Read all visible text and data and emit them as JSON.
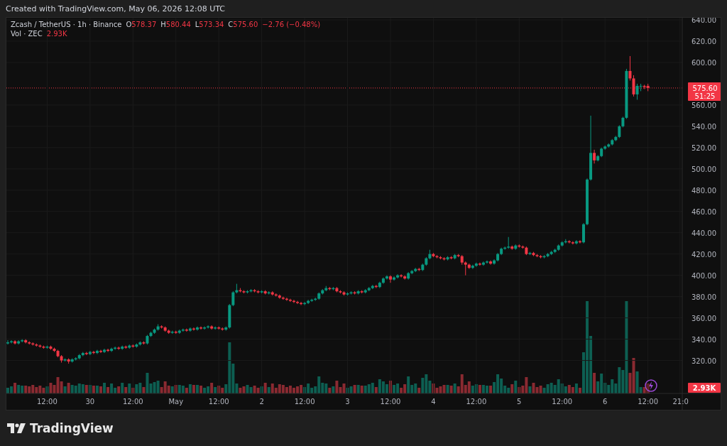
{
  "caption": "Created with TradingView.com, May 06, 2026 12:08 UTC",
  "legend": {
    "symbol": "Zcash / TetherUS · 1h · Binance",
    "ohlc": [
      {
        "label": "O",
        "value": "578.37"
      },
      {
        "label": "H",
        "value": "580.44"
      },
      {
        "label": "L",
        "value": "573.34"
      },
      {
        "label": "C",
        "value": "575.60"
      }
    ],
    "change": "−2.76 (−0.48%)",
    "volume_label": "Vol · ZEC",
    "volume_value": "2.93K"
  },
  "chart": {
    "chart_data": {
      "type": "candlestick",
      "categories": [
        null,
        null,
        null,
        null,
        null,
        null,
        null,
        null,
        null,
        null,
        null,
        "12:00",
        null,
        null,
        null,
        null,
        null,
        null,
        null,
        null,
        null,
        null,
        null,
        "30",
        null,
        null,
        null,
        null,
        null,
        null,
        null,
        null,
        null,
        null,
        null,
        "12:00",
        null,
        null,
        null,
        null,
        null,
        null,
        null,
        null,
        null,
        null,
        null,
        "May",
        null,
        null,
        null,
        null,
        null,
        null,
        null,
        null,
        null,
        null,
        null,
        "12:00",
        null,
        null,
        null,
        null,
        null,
        null,
        null,
        null,
        null,
        null,
        null,
        "2",
        null,
        null,
        null,
        null,
        null,
        null,
        null,
        null,
        null,
        null,
        null,
        "12:00",
        null,
        null,
        null,
        null,
        null,
        null,
        null,
        null,
        null,
        null,
        null,
        "3",
        null,
        null,
        null,
        null,
        null,
        null,
        null,
        null,
        null,
        null,
        null,
        "12:00",
        null,
        null,
        null,
        null,
        null,
        null,
        null,
        null,
        null,
        null,
        null,
        "4",
        null,
        null,
        null,
        null,
        null,
        null,
        null,
        null,
        null,
        null,
        null,
        "12:00",
        null,
        null,
        null,
        null,
        null,
        null,
        null,
        null,
        null,
        null,
        null,
        "5",
        null,
        null,
        null,
        null,
        null,
        null,
        null,
        null,
        null,
        null,
        null,
        "12:00",
        null,
        null,
        null,
        null,
        null,
        null,
        null,
        null,
        null,
        null,
        null,
        "6",
        null,
        null,
        null,
        null,
        null,
        null,
        null,
        null,
        null,
        null,
        null,
        "12:00",
        null,
        null,
        null,
        null,
        null,
        null,
        null,
        null,
        "21:0"
      ],
      "ohlc": [
        [
          336,
          339,
          335,
          337
        ],
        [
          337,
          339,
          336,
          338
        ],
        [
          338,
          339,
          335,
          336
        ],
        [
          336,
          339,
          335,
          338
        ],
        [
          338,
          340,
          337,
          339
        ],
        [
          339,
          340,
          336,
          337
        ],
        [
          337,
          338,
          335,
          336
        ],
        [
          336,
          337,
          334,
          335
        ],
        [
          335,
          336,
          333,
          334
        ],
        [
          334,
          335,
          332,
          333
        ],
        [
          333,
          334,
          331,
          332
        ],
        [
          332,
          334,
          331,
          333
        ],
        [
          333,
          334,
          330,
          331
        ],
        [
          331,
          332,
          328,
          329
        ],
        [
          329,
          330,
          323,
          324
        ],
        [
          324,
          325,
          318,
          320
        ],
        [
          320,
          322,
          319,
          321
        ],
        [
          321,
          322,
          317,
          319
        ],
        [
          319,
          322,
          318,
          321
        ],
        [
          321,
          323,
          320,
          322
        ],
        [
          322,
          326,
          321,
          325
        ],
        [
          325,
          328,
          324,
          327
        ],
        [
          327,
          328,
          325,
          326
        ],
        [
          326,
          329,
          325,
          328
        ],
        [
          328,
          329,
          326,
          327
        ],
        [
          327,
          330,
          326,
          329
        ],
        [
          329,
          330,
          327,
          328
        ],
        [
          328,
          331,
          327,
          330
        ],
        [
          330,
          331,
          328,
          329
        ],
        [
          329,
          332,
          328,
          331
        ],
        [
          331,
          333,
          330,
          332
        ],
        [
          332,
          333,
          330,
          331
        ],
        [
          331,
          334,
          330,
          333
        ],
        [
          333,
          334,
          331,
          332
        ],
        [
          332,
          335,
          331,
          334
        ],
        [
          334,
          335,
          332,
          333
        ],
        [
          333,
          336,
          332,
          335
        ],
        [
          335,
          338,
          334,
          337
        ],
        [
          337,
          338,
          335,
          336
        ],
        [
          336,
          344,
          335,
          343
        ],
        [
          343,
          347,
          342,
          346
        ],
        [
          346,
          350,
          345,
          349
        ],
        [
          349,
          354,
          348,
          352
        ],
        [
          352,
          353,
          350,
          351
        ],
        [
          351,
          352,
          347,
          348
        ],
        [
          348,
          349,
          345,
          346
        ],
        [
          346,
          348,
          345,
          347
        ],
        [
          347,
          348,
          345,
          346
        ],
        [
          346,
          349,
          345,
          348
        ],
        [
          348,
          350,
          347,
          349
        ],
        [
          349,
          350,
          347,
          348
        ],
        [
          348,
          351,
          347,
          350
        ],
        [
          350,
          351,
          348,
          349
        ],
        [
          349,
          352,
          348,
          351
        ],
        [
          351,
          352,
          349,
          350
        ],
        [
          350,
          352,
          349,
          351
        ],
        [
          351,
          353,
          350,
          352
        ],
        [
          352,
          353,
          349,
          350
        ],
        [
          350,
          352,
          349,
          351
        ],
        [
          351,
          352,
          349,
          350
        ],
        [
          350,
          351,
          348,
          349
        ],
        [
          349,
          352,
          348,
          351
        ],
        [
          351,
          373,
          350,
          372
        ],
        [
          372,
          385,
          371,
          384
        ],
        [
          384,
          392,
          383,
          386
        ],
        [
          386,
          388,
          384,
          385
        ],
        [
          385,
          386,
          383,
          384
        ],
        [
          384,
          386,
          383,
          385
        ],
        [
          385,
          387,
          384,
          386
        ],
        [
          386,
          387,
          384,
          385
        ],
        [
          385,
          386,
          383,
          384
        ],
        [
          384,
          386,
          383,
          385
        ],
        [
          385,
          386,
          382,
          383
        ],
        [
          383,
          385,
          382,
          384
        ],
        [
          384,
          385,
          381,
          382
        ],
        [
          382,
          383,
          380,
          381
        ],
        [
          381,
          382,
          378,
          379
        ],
        [
          379,
          380,
          377,
          378
        ],
        [
          378,
          379,
          376,
          377
        ],
        [
          377,
          378,
          375,
          376
        ],
        [
          376,
          377,
          374,
          375
        ],
        [
          375,
          376,
          373,
          374
        ],
        [
          374,
          375,
          372,
          373
        ],
        [
          373,
          375,
          372,
          374
        ],
        [
          374,
          377,
          373,
          376
        ],
        [
          376,
          378,
          375,
          377
        ],
        [
          377,
          379,
          376,
          378
        ],
        [
          378,
          384,
          377,
          383
        ],
        [
          383,
          387,
          382,
          386
        ],
        [
          386,
          390,
          385,
          388
        ],
        [
          388,
          389,
          386,
          387
        ],
        [
          387,
          389,
          386,
          388
        ],
        [
          388,
          389,
          384,
          385
        ],
        [
          385,
          386,
          383,
          384
        ],
        [
          384,
          385,
          381,
          382
        ],
        [
          382,
          384,
          381,
          383
        ],
        [
          383,
          385,
          382,
          384
        ],
        [
          384,
          385,
          382,
          383
        ],
        [
          383,
          386,
          382,
          385
        ],
        [
          385,
          386,
          383,
          384
        ],
        [
          384,
          387,
          383,
          386
        ],
        [
          386,
          389,
          385,
          388
        ],
        [
          388,
          391,
          387,
          390
        ],
        [
          390,
          391,
          388,
          389
        ],
        [
          389,
          394,
          388,
          393
        ],
        [
          393,
          398,
          392,
          397
        ],
        [
          397,
          400,
          396,
          399
        ],
        [
          399,
          400,
          393,
          396
        ],
        [
          396,
          399,
          395,
          398
        ],
        [
          398,
          401,
          397,
          400
        ],
        [
          400,
          401,
          398,
          399
        ],
        [
          399,
          400,
          396,
          397
        ],
        [
          397,
          403,
          396,
          402
        ],
        [
          402,
          405,
          401,
          404
        ],
        [
          404,
          407,
          403,
          406
        ],
        [
          406,
          407,
          404,
          405
        ],
        [
          405,
          411,
          404,
          410
        ],
        [
          410,
          417,
          409,
          416
        ],
        [
          416,
          424,
          415,
          420
        ],
        [
          420,
          421,
          417,
          418
        ],
        [
          418,
          419,
          416,
          417
        ],
        [
          417,
          418,
          415,
          416
        ],
        [
          416,
          417,
          414,
          415
        ],
        [
          415,
          418,
          414,
          417
        ],
        [
          417,
          418,
          415,
          416
        ],
        [
          416,
          420,
          415,
          419
        ],
        [
          419,
          420,
          417,
          418
        ],
        [
          418,
          419,
          410,
          412
        ],
        [
          412,
          413,
          400,
          410
        ],
        [
          410,
          411,
          406,
          407
        ],
        [
          407,
          410,
          406,
          409
        ],
        [
          409,
          412,
          408,
          411
        ],
        [
          411,
          412,
          409,
          410
        ],
        [
          410,
          413,
          409,
          412
        ],
        [
          412,
          414,
          411,
          413
        ],
        [
          413,
          414,
          410,
          411
        ],
        [
          411,
          415,
          410,
          414
        ],
        [
          414,
          421,
          413,
          420
        ],
        [
          420,
          426,
          419,
          425
        ],
        [
          425,
          427,
          424,
          426
        ],
        [
          426,
          436,
          425,
          427
        ],
        [
          427,
          428,
          424,
          425
        ],
        [
          425,
          429,
          424,
          428
        ],
        [
          428,
          429,
          426,
          427
        ],
        [
          427,
          428,
          425,
          426
        ],
        [
          426,
          427,
          419,
          420
        ],
        [
          420,
          422,
          419,
          421
        ],
        [
          421,
          422,
          418,
          419
        ],
        [
          419,
          420,
          417,
          418
        ],
        [
          418,
          419,
          416,
          417
        ],
        [
          417,
          419,
          416,
          418
        ],
        [
          418,
          421,
          417,
          420
        ],
        [
          420,
          423,
          419,
          422
        ],
        [
          422,
          425,
          421,
          424
        ],
        [
          424,
          429,
          423,
          428
        ],
        [
          428,
          432,
          427,
          431
        ],
        [
          431,
          434,
          430,
          432
        ],
        [
          432,
          433,
          430,
          431
        ],
        [
          431,
          432,
          429,
          430
        ],
        [
          430,
          433,
          429,
          432
        ],
        [
          432,
          433,
          430,
          431
        ],
        [
          431,
          449,
          430,
          448
        ],
        [
          448,
          491,
          447,
          490
        ],
        [
          490,
          550,
          489,
          515
        ],
        [
          515,
          518,
          505,
          508
        ],
        [
          508,
          513,
          507,
          512
        ],
        [
          512,
          520,
          511,
          519
        ],
        [
          519,
          522,
          518,
          521
        ],
        [
          521,
          524,
          520,
          523
        ],
        [
          523,
          528,
          522,
          527
        ],
        [
          527,
          531,
          526,
          530
        ],
        [
          530,
          541,
          529,
          540
        ],
        [
          540,
          549,
          539,
          548
        ],
        [
          548,
          594,
          547,
          592
        ],
        [
          592,
          606,
          583,
          585
        ],
        [
          585,
          588,
          568,
          570
        ],
        [
          570,
          580,
          565,
          578
        ],
        [
          578,
          580,
          573,
          578
        ],
        [
          578,
          579,
          575,
          577
        ],
        [
          578,
          580,
          573,
          576
        ],
        null,
        null,
        null,
        null,
        null,
        null,
        null,
        null,
        null
      ],
      "ylim": [
        289,
        642
      ],
      "grid": true,
      "yticks": [
        {
          "value": 640,
          "label": "640.00"
        },
        {
          "value": 620,
          "label": "620.00"
        },
        {
          "value": 600,
          "label": "600.00"
        },
        {
          "value": 560,
          "label": "560.00"
        },
        {
          "value": 540,
          "label": "540.00"
        },
        {
          "value": 520,
          "label": "520.00"
        },
        {
          "value": 500,
          "label": "500.00"
        },
        {
          "value": 480,
          "label": "480.00"
        },
        {
          "value": 460,
          "label": "460.00"
        },
        {
          "value": 440,
          "label": "440.00"
        },
        {
          "value": 420,
          "label": "420.00"
        },
        {
          "value": 400,
          "label": "400.00"
        },
        {
          "value": 380,
          "label": "380.00"
        },
        {
          "value": 360,
          "label": "360.00"
        },
        {
          "value": 340,
          "label": "340.00"
        },
        {
          "value": 320,
          "label": "320.00"
        }
      ]
    },
    "last_price": "575.60",
    "countdown": "51:25",
    "volume_tag": "2.93K"
  },
  "footer": {
    "brand": "TradingView"
  }
}
